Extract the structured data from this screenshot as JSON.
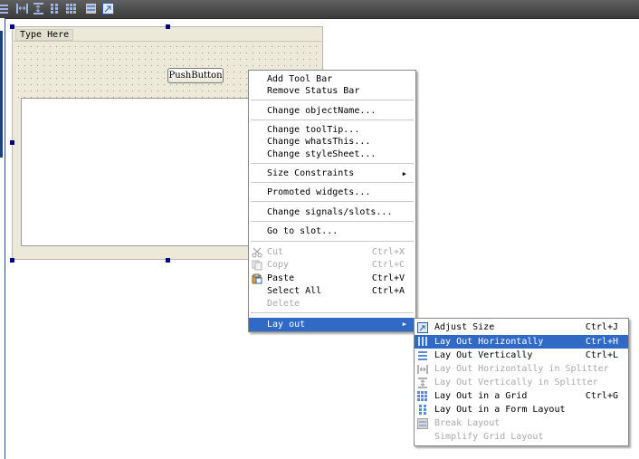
{
  "form": {
    "menubar_placeholder": "Type Here",
    "push_button_label": "PushButton"
  },
  "context_menu": {
    "items": [
      {
        "label": "Add Tool Bar"
      },
      {
        "label": "Remove Status Bar"
      },
      {
        "label": "Change objectName..."
      },
      {
        "label": "Change toolTip..."
      },
      {
        "label": "Change whatsThis..."
      },
      {
        "label": "Change styleSheet..."
      },
      {
        "label": "Size Constraints"
      },
      {
        "label": "Promoted widgets..."
      },
      {
        "label": "Change signals/slots..."
      },
      {
        "label": "Go to slot..."
      },
      {
        "label": "Cut",
        "shortcut": "Ctrl+X",
        "icon": "cut-icon",
        "enabled": false
      },
      {
        "label": "Copy",
        "shortcut": "Ctrl+C",
        "icon": "copy-icon",
        "enabled": false
      },
      {
        "label": "Paste",
        "shortcut": "Ctrl+V",
        "icon": "paste-icon",
        "enabled": true
      },
      {
        "label": "Select All",
        "shortcut": "Ctrl+A",
        "enabled": true
      },
      {
        "label": "Delete",
        "enabled": false
      },
      {
        "label": "Lay out",
        "highlighted": true
      }
    ]
  },
  "layout_submenu": {
    "items": [
      {
        "label": "Adjust Size",
        "shortcut": "Ctrl+J",
        "icon": "adjust-size-icon",
        "enabled": true
      },
      {
        "label": "Lay Out Horizontally",
        "shortcut": "Ctrl+H",
        "icon": "horizontal-layout-icon",
        "enabled": true,
        "highlighted": true
      },
      {
        "label": "Lay Out Vertically",
        "shortcut": "Ctrl+L",
        "icon": "vertical-layout-icon",
        "enabled": true
      },
      {
        "label": "Lay Out Horizontally in Splitter",
        "icon": "horizontal-splitter-icon",
        "enabled": false
      },
      {
        "label": "Lay Out Vertically in Splitter",
        "icon": "vertical-splitter-icon",
        "enabled": false
      },
      {
        "label": "Lay Out in a Grid",
        "shortcut": "Ctrl+G",
        "icon": "grid-layout-icon",
        "enabled": true
      },
      {
        "label": "Lay Out in a Form Layout",
        "icon": "form-layout-icon",
        "enabled": true
      },
      {
        "label": "Break Layout",
        "icon": "break-layout-icon",
        "enabled": false
      },
      {
        "label": "Simplify Grid Layout",
        "enabled": false
      }
    ]
  },
  "colors": {
    "highlight": "#316ac5",
    "selection_handle": "#00008b",
    "form_background": "#ece9d8",
    "toolbar_background": "#4a4a4a"
  }
}
